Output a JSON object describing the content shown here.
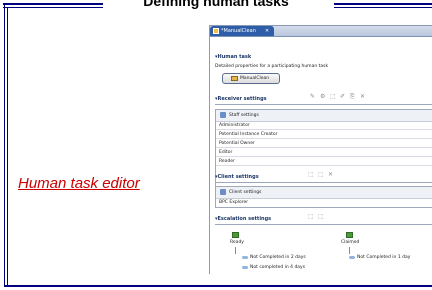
{
  "slide": {
    "title": "Defining human tasks",
    "side_label": "Human task editor"
  },
  "editor": {
    "tab_label": "*ManualClean",
    "tab_close": "✕",
    "human_task": {
      "heading": "▾Human task",
      "description": "Detailed properties for a participating human task",
      "button_label": "ManualClean"
    },
    "receiver_settings": {
      "heading": "▾Receiver settings",
      "toolbar": [
        "✎",
        "⚙",
        "⬚",
        "✐",
        "⎘",
        "✕"
      ],
      "box_header": "Staff settings",
      "roles": [
        "Administrator",
        "Potential Instance Creator",
        "Potential Owner",
        "Editor",
        "Reader"
      ]
    },
    "client_settings": {
      "heading": "▾Client settings",
      "toolbar": [
        "⬚",
        "⬚",
        "✕"
      ],
      "box_header": "Client settings",
      "clients": [
        "BPC Explorer"
      ]
    },
    "escalation_settings": {
      "heading": "▾Escalation settings",
      "toolbar": [
        "⬚",
        "⬚"
      ],
      "states": [
        "Ready",
        "Claimed"
      ],
      "ready_escalations": [
        "Not Completed in 2 days",
        "Not completed in 4 days"
      ],
      "claimed_escalations": [
        "Not Completed in 1 day"
      ]
    }
  }
}
